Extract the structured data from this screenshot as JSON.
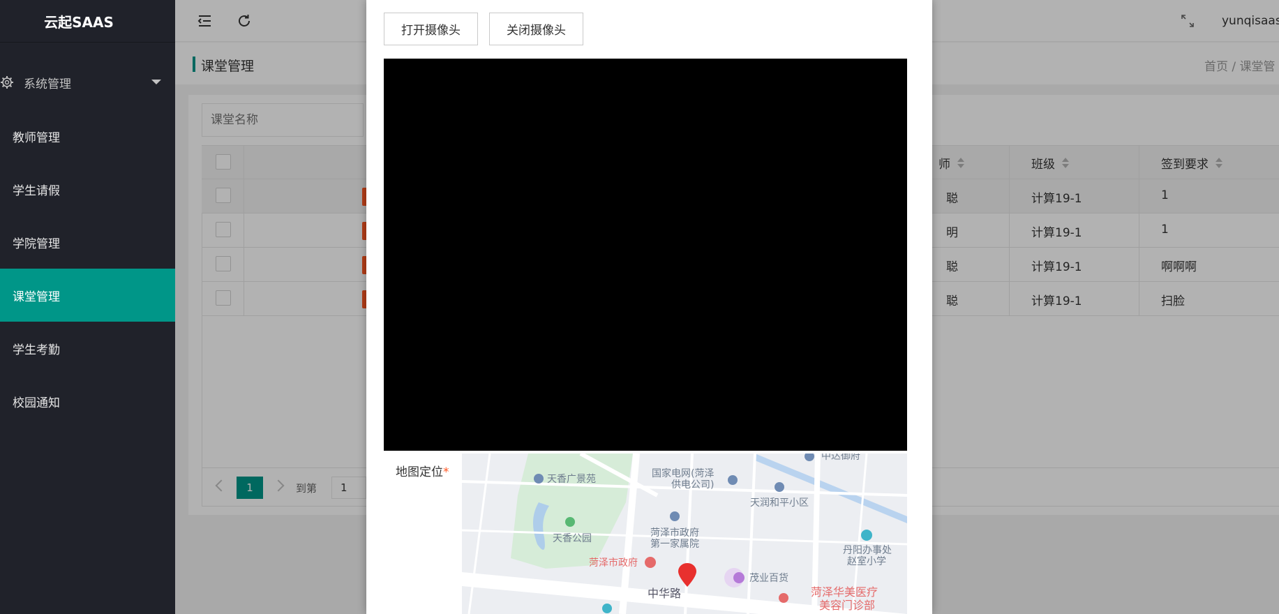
{
  "app": {
    "logo": "云起SAAS"
  },
  "sidebar": {
    "group": {
      "label": "系统管理"
    },
    "items": [
      {
        "label": "教师管理"
      },
      {
        "label": "学生请假"
      },
      {
        "label": "学院管理"
      },
      {
        "label": "课堂管理"
      },
      {
        "label": "学生考勤"
      },
      {
        "label": "校园通知"
      }
    ]
  },
  "header": {
    "user": "yunqisaas"
  },
  "subbar": {
    "title": "课堂管理",
    "breadcrumb": "首页  /  课堂管"
  },
  "search": {
    "placeholder": "课堂名称"
  },
  "table": {
    "columns": {
      "teacher_partial": "师",
      "class": "班级",
      "requirement": "签到要求"
    },
    "rows": [
      {
        "teacher": "聪",
        "class": "计算19-1",
        "requirement": "1"
      },
      {
        "teacher": "明",
        "class": "计算19-1",
        "requirement": "1"
      },
      {
        "teacher": "聪",
        "class": "计算19-1",
        "requirement": "啊啊啊"
      },
      {
        "teacher": "聪",
        "class": "计算19-1",
        "requirement": "扫脸"
      }
    ]
  },
  "pager": {
    "current": "1",
    "goto_label": "到第",
    "goto_value": "1"
  },
  "modal": {
    "open_camera": "打开摄像头",
    "close_camera": "关闭摄像头",
    "map_label": "地图定位",
    "required_mark": "*"
  },
  "map": {
    "labels": [
      "中达御府",
      "天香广景苑",
      "国家电网(菏泽",
      "供电公司)",
      "天润和平小区",
      "菏泽市政府",
      "第一家属院",
      "天香公园",
      "丹阳办事处",
      "赵室小学",
      "菏泽市政府",
      "茂业百货",
      "中华路",
      "菏泽华美医疗",
      "美容门诊部"
    ]
  },
  "colors": {
    "accent": "#009688",
    "sidebar": "#20222a",
    "danger": "#ff5722"
  }
}
